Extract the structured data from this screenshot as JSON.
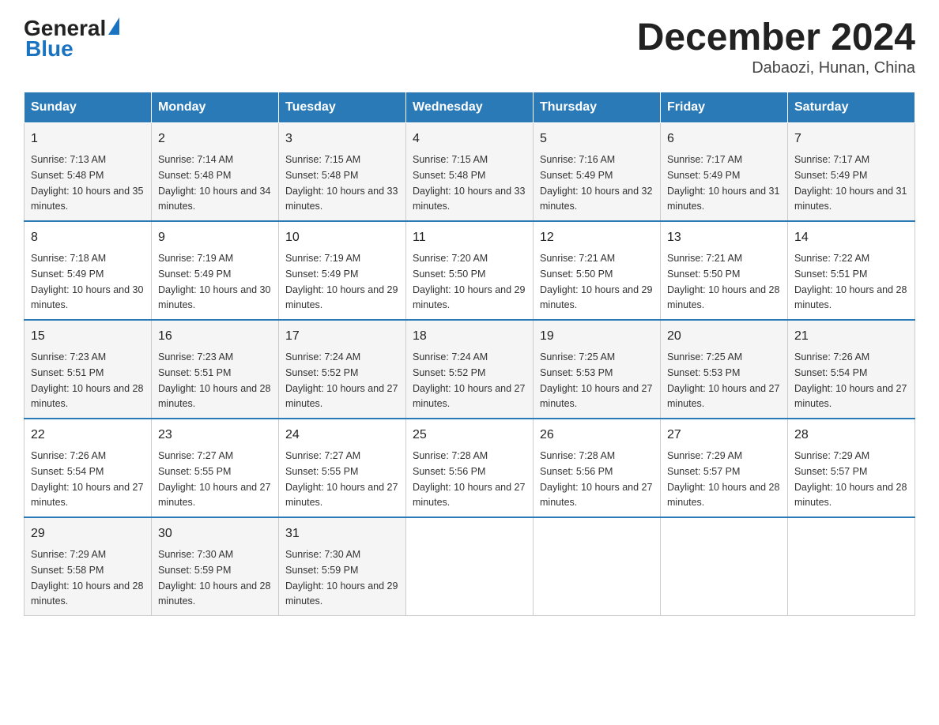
{
  "header": {
    "logo_general": "General",
    "logo_blue": "Blue",
    "month_title": "December 2024",
    "location": "Dabaozi, Hunan, China"
  },
  "weekdays": [
    "Sunday",
    "Monday",
    "Tuesday",
    "Wednesday",
    "Thursday",
    "Friday",
    "Saturday"
  ],
  "weeks": [
    [
      {
        "day": "1",
        "sunrise": "7:13 AM",
        "sunset": "5:48 PM",
        "daylight": "10 hours and 35 minutes."
      },
      {
        "day": "2",
        "sunrise": "7:14 AM",
        "sunset": "5:48 PM",
        "daylight": "10 hours and 34 minutes."
      },
      {
        "day": "3",
        "sunrise": "7:15 AM",
        "sunset": "5:48 PM",
        "daylight": "10 hours and 33 minutes."
      },
      {
        "day": "4",
        "sunrise": "7:15 AM",
        "sunset": "5:48 PM",
        "daylight": "10 hours and 33 minutes."
      },
      {
        "day": "5",
        "sunrise": "7:16 AM",
        "sunset": "5:49 PM",
        "daylight": "10 hours and 32 minutes."
      },
      {
        "day": "6",
        "sunrise": "7:17 AM",
        "sunset": "5:49 PM",
        "daylight": "10 hours and 31 minutes."
      },
      {
        "day": "7",
        "sunrise": "7:17 AM",
        "sunset": "5:49 PM",
        "daylight": "10 hours and 31 minutes."
      }
    ],
    [
      {
        "day": "8",
        "sunrise": "7:18 AM",
        "sunset": "5:49 PM",
        "daylight": "10 hours and 30 minutes."
      },
      {
        "day": "9",
        "sunrise": "7:19 AM",
        "sunset": "5:49 PM",
        "daylight": "10 hours and 30 minutes."
      },
      {
        "day": "10",
        "sunrise": "7:19 AM",
        "sunset": "5:49 PM",
        "daylight": "10 hours and 29 minutes."
      },
      {
        "day": "11",
        "sunrise": "7:20 AM",
        "sunset": "5:50 PM",
        "daylight": "10 hours and 29 minutes."
      },
      {
        "day": "12",
        "sunrise": "7:21 AM",
        "sunset": "5:50 PM",
        "daylight": "10 hours and 29 minutes."
      },
      {
        "day": "13",
        "sunrise": "7:21 AM",
        "sunset": "5:50 PM",
        "daylight": "10 hours and 28 minutes."
      },
      {
        "day": "14",
        "sunrise": "7:22 AM",
        "sunset": "5:51 PM",
        "daylight": "10 hours and 28 minutes."
      }
    ],
    [
      {
        "day": "15",
        "sunrise": "7:23 AM",
        "sunset": "5:51 PM",
        "daylight": "10 hours and 28 minutes."
      },
      {
        "day": "16",
        "sunrise": "7:23 AM",
        "sunset": "5:51 PM",
        "daylight": "10 hours and 28 minutes."
      },
      {
        "day": "17",
        "sunrise": "7:24 AM",
        "sunset": "5:52 PM",
        "daylight": "10 hours and 27 minutes."
      },
      {
        "day": "18",
        "sunrise": "7:24 AM",
        "sunset": "5:52 PM",
        "daylight": "10 hours and 27 minutes."
      },
      {
        "day": "19",
        "sunrise": "7:25 AM",
        "sunset": "5:53 PM",
        "daylight": "10 hours and 27 minutes."
      },
      {
        "day": "20",
        "sunrise": "7:25 AM",
        "sunset": "5:53 PM",
        "daylight": "10 hours and 27 minutes."
      },
      {
        "day": "21",
        "sunrise": "7:26 AM",
        "sunset": "5:54 PM",
        "daylight": "10 hours and 27 minutes."
      }
    ],
    [
      {
        "day": "22",
        "sunrise": "7:26 AM",
        "sunset": "5:54 PM",
        "daylight": "10 hours and 27 minutes."
      },
      {
        "day": "23",
        "sunrise": "7:27 AM",
        "sunset": "5:55 PM",
        "daylight": "10 hours and 27 minutes."
      },
      {
        "day": "24",
        "sunrise": "7:27 AM",
        "sunset": "5:55 PM",
        "daylight": "10 hours and 27 minutes."
      },
      {
        "day": "25",
        "sunrise": "7:28 AM",
        "sunset": "5:56 PM",
        "daylight": "10 hours and 27 minutes."
      },
      {
        "day": "26",
        "sunrise": "7:28 AM",
        "sunset": "5:56 PM",
        "daylight": "10 hours and 27 minutes."
      },
      {
        "day": "27",
        "sunrise": "7:29 AM",
        "sunset": "5:57 PM",
        "daylight": "10 hours and 28 minutes."
      },
      {
        "day": "28",
        "sunrise": "7:29 AM",
        "sunset": "5:57 PM",
        "daylight": "10 hours and 28 minutes."
      }
    ],
    [
      {
        "day": "29",
        "sunrise": "7:29 AM",
        "sunset": "5:58 PM",
        "daylight": "10 hours and 28 minutes."
      },
      {
        "day": "30",
        "sunrise": "7:30 AM",
        "sunset": "5:59 PM",
        "daylight": "10 hours and 28 minutes."
      },
      {
        "day": "31",
        "sunrise": "7:30 AM",
        "sunset": "5:59 PM",
        "daylight": "10 hours and 29 minutes."
      },
      null,
      null,
      null,
      null
    ]
  ],
  "labels": {
    "sunrise_prefix": "Sunrise: ",
    "sunset_prefix": "Sunset: ",
    "daylight_prefix": "Daylight: "
  }
}
